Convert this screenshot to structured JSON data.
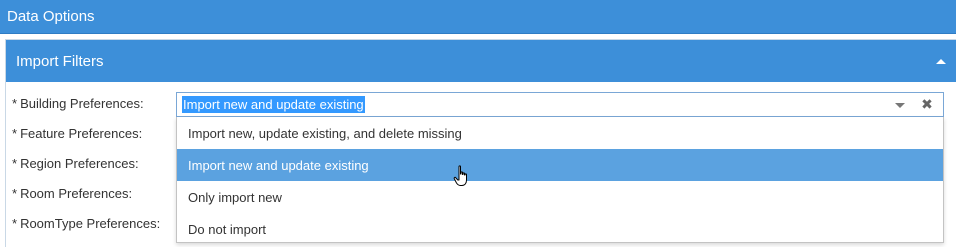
{
  "header": {
    "title": "Data Options"
  },
  "panel": {
    "title": "Import Filters"
  },
  "fields": [
    {
      "required": "*",
      "label": "Building Preferences:"
    },
    {
      "required": "*",
      "label": "Feature Preferences:"
    },
    {
      "required": "*",
      "label": "Region Preferences:"
    },
    {
      "required": "*",
      "label": "Room Preferences:"
    },
    {
      "required": "*",
      "label": "RoomType Preferences:"
    }
  ],
  "building_select": {
    "value": "Import new and update existing",
    "clear_icon": "close-icon",
    "options": [
      {
        "label": "Import new, update existing, and delete missing"
      },
      {
        "label": "Import new and update existing"
      },
      {
        "label": "Only import new"
      },
      {
        "label": "Do not import"
      }
    ]
  },
  "colors": {
    "header_bg": "#3d8fd9",
    "selected_option_bg": "#5ba2e0",
    "text_highlight": "#3399ff"
  }
}
